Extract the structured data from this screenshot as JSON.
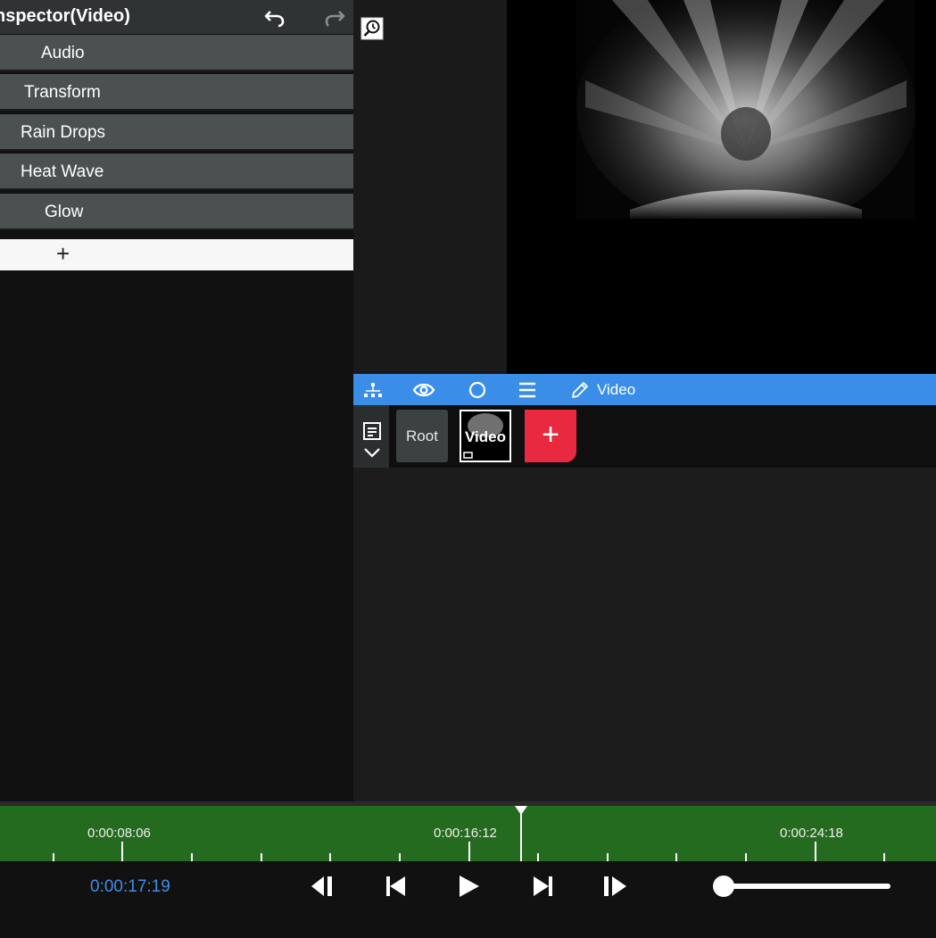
{
  "inspector": {
    "title": "nspector(Video)",
    "effects": [
      {
        "label": "Audio"
      },
      {
        "label": "Transform"
      },
      {
        "label": "Rain Drops"
      },
      {
        "label": "Heat Wave"
      },
      {
        "label": "Glow"
      }
    ],
    "add_label": "+"
  },
  "toolbar": {
    "icons": [
      "hierarchy-icon",
      "eye-icon",
      "circle-icon",
      "menu-icon",
      "pencil-icon"
    ],
    "edit_label": "Video"
  },
  "layers": {
    "root_label": "Root",
    "video_label": "Video",
    "add_label": "+"
  },
  "timeline": {
    "tick_labels": [
      "0:00:08:06",
      "0:00:16:12",
      "0:00:24:18"
    ],
    "current_time": "0:00:17:19"
  },
  "colors": {
    "accent_blue": "#3a8ee8",
    "timeline_green": "#256b1f",
    "add_red": "#e8293f"
  }
}
